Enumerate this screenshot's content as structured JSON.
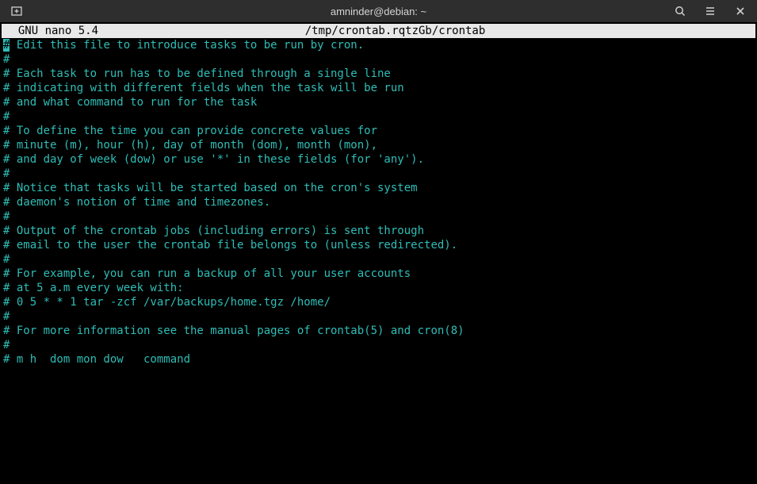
{
  "titlebar": {
    "title": "amninder@debian: ~"
  },
  "nano": {
    "app_label": "  GNU nano 5.4",
    "file_path": "/tmp/crontab.rqtzGb/crontab"
  },
  "lines": [
    {
      "prefix_cursor": "#",
      "text": " Edit this file to introduce tasks to be run by cron."
    },
    {
      "prefix": "#",
      "text": ""
    },
    {
      "prefix": "#",
      "text": " Each task to run has to be defined through a single line"
    },
    {
      "prefix": "#",
      "text": " indicating with different fields when the task will be run"
    },
    {
      "prefix": "#",
      "text": " and what command to run for the task"
    },
    {
      "prefix": "#",
      "text": ""
    },
    {
      "prefix": "#",
      "text": " To define the time you can provide concrete values for"
    },
    {
      "prefix": "#",
      "text": " minute (m), hour (h), day of month (dom), month (mon),"
    },
    {
      "prefix": "#",
      "text": " and day of week (dow) or use '*' in these fields (for 'any')."
    },
    {
      "prefix": "#",
      "text": ""
    },
    {
      "prefix": "#",
      "text": " Notice that tasks will be started based on the cron's system"
    },
    {
      "prefix": "#",
      "text": " daemon's notion of time and timezones."
    },
    {
      "prefix": "#",
      "text": ""
    },
    {
      "prefix": "#",
      "text": " Output of the crontab jobs (including errors) is sent through"
    },
    {
      "prefix": "#",
      "text": " email to the user the crontab file belongs to (unless redirected)."
    },
    {
      "prefix": "#",
      "text": ""
    },
    {
      "prefix": "#",
      "text": " For example, you can run a backup of all your user accounts"
    },
    {
      "prefix": "#",
      "text": " at 5 a.m every week with:"
    },
    {
      "prefix": "#",
      "text": " 0 5 * * 1 tar -zcf /var/backups/home.tgz /home/"
    },
    {
      "prefix": "#",
      "text": ""
    },
    {
      "prefix": "#",
      "text": " For more information see the manual pages of crontab(5) and cron(8)"
    },
    {
      "prefix": "#",
      "text": ""
    },
    {
      "prefix": "#",
      "text": " m h  dom mon dow   command"
    }
  ]
}
